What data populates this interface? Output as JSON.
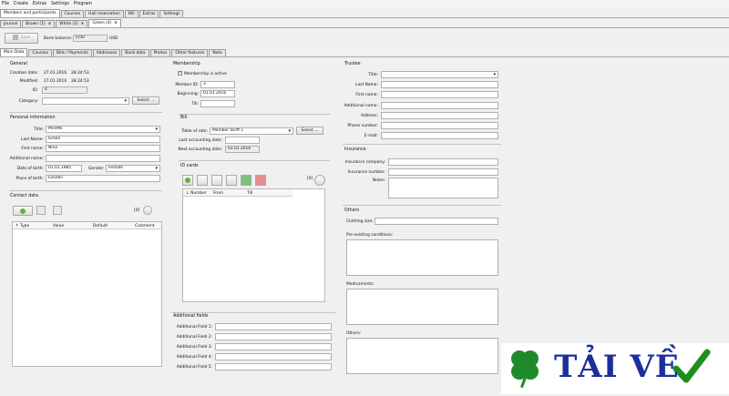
{
  "menu": [
    "File",
    "Create",
    "Extras",
    "Settings",
    "Program"
  ],
  "main_tabs": [
    "Members and participants",
    "Courses",
    "Hall reservation",
    "Bill",
    "Extras",
    "Settings"
  ],
  "view_tabs": [
    {
      "label": "Journal",
      "close": false
    },
    {
      "label": "Brown (1)",
      "close": true
    },
    {
      "label": "White (2)",
      "close": true
    },
    {
      "label": "Green (4)",
      "close": true
    }
  ],
  "toolbar": {
    "save_label": "Save",
    "bank_balance_label": "Bank balance:",
    "bank_balance_value": "0,00",
    "currency": "USD"
  },
  "sub_tabs": [
    "Main Data",
    "Courses",
    "Bills / Payments",
    "Addresses",
    "Bank data",
    "Photos",
    "Other features",
    "Note"
  ],
  "general": {
    "title": "General",
    "creation_date_label": "Creation date:",
    "creation_date": "27.01.2016",
    "creation_time": "28:24:53",
    "modified_label": "Modified:",
    "modified_date": "27.01.2016",
    "modified_time": "28:24:53",
    "id_label": "ID:",
    "id_value": "4",
    "category_label": "Category:",
    "category_value": "",
    "select_label": "Select ..."
  },
  "personal": {
    "title": "Personal information",
    "title_label": "Title:",
    "title_value": "Mrs/Ms",
    "last_name_label": "Last Name:",
    "last_name": "Green",
    "first_name_label": "First name:",
    "first_name": "Nina",
    "additional_name_label": "Additional name:",
    "additional_name": "",
    "dob_label": "Date of birth:",
    "dob": "01.01.1985",
    "gender_label": "Gender:",
    "gender": "Female",
    "pob_label": "Place of birth:",
    "pob": "London"
  },
  "contact": {
    "title": "Contact data",
    "count": "[0]",
    "columns": [
      "Type",
      "Value",
      "Default",
      "Comment"
    ]
  },
  "membership": {
    "title": "Membership",
    "active_label": "Membership is active",
    "member_id_label": "Member ID:",
    "member_id": "3",
    "beginning_label": "Beginning:",
    "beginning": "01.01.2016",
    "till_label": "Till:",
    "till": ""
  },
  "bill": {
    "title": "Bill",
    "table_of_rate_label": "Table of rate:",
    "table_of_rate": "Member tariff 1",
    "select_label": "Select ...",
    "last_accounting_label": "Last accounting date:",
    "last_accounting": "",
    "next_accounting_label": "Next accounting date:",
    "next_accounting": "01.01.2016"
  },
  "id_cards": {
    "title": "ID cards",
    "count": "[0]",
    "columns": [
      "Number",
      "From",
      "Till"
    ]
  },
  "additional_fields": {
    "title": "Additional fields",
    "labels": [
      "Additional Field 1:",
      "Additional Field 2:",
      "Additional Field 3:",
      "Additional Field 4:",
      "Additional Field 5:"
    ]
  },
  "trustee": {
    "title": "Trustee",
    "labels": [
      "Title:",
      "Last Name:",
      "First name:",
      "Additional name:",
      "Address:",
      "Phone number:",
      "E-mail:"
    ]
  },
  "insurance": {
    "title": "Insurance",
    "company_label": "Insurance company:",
    "number_label": "Insurance number:",
    "notes_label": "Notes:"
  },
  "others": {
    "title": "Others",
    "clothing_label": "Clothing size:",
    "pre_existing_label": "Pre-existing conditions:",
    "medicaments_label": "Medicaments:",
    "others_label": "Others:"
  },
  "watermark": {
    "text": "TẢI VỀ",
    "color": "#1a2f9c",
    "check_color": "#1e8f1e",
    "clover_color": "#1f8a2a"
  }
}
